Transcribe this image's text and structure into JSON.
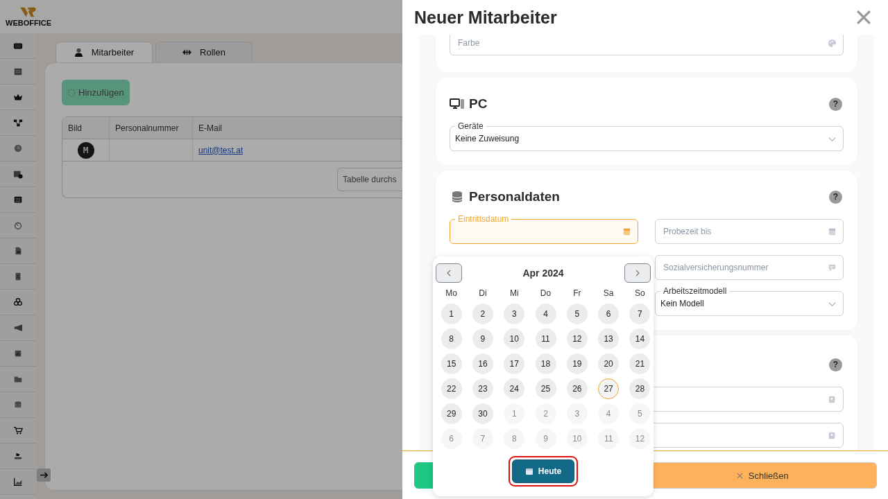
{
  "app": {
    "logo": "WEBOFFICE",
    "tabs": [
      {
        "label": "Mitarbeiter",
        "selected": true
      },
      {
        "label": "Rollen",
        "selected": false
      }
    ],
    "add_button": {
      "label": "Hinzufügen",
      "disabled": true
    },
    "table": {
      "columns": [
        "Bild",
        "Personalnummer",
        "E-Mail"
      ],
      "rows": [
        {
          "avatar": "M",
          "email": "unit@test.at"
        }
      ]
    },
    "search": {
      "placeholder": "Tabelle durchs"
    }
  },
  "modal": {
    "title": "Neuer Mitarbeiter",
    "sections": [
      {
        "kind": "plain",
        "columns": [
          [
            {
              "kind": "color",
              "placeholder": "Farbe"
            }
          ]
        ]
      },
      {
        "kind": "pc",
        "title": "PC",
        "help": "?",
        "columns": [
          [
            {
              "kind": "select",
              "label": "Geräte",
              "value": "Keine Zuweisung"
            }
          ]
        ]
      },
      {
        "kind": "data",
        "title": "Personaldaten",
        "help": "?",
        "columns": [
          [
            {
              "kind": "date",
              "label": "Eintrittsdatum",
              "focused": true
            }
          ],
          [
            {
              "kind": "date",
              "placeholder": "Probezeit bis"
            },
            {
              "kind": "note",
              "placeholder": "Sozialversicherungsnummer"
            },
            {
              "kind": "select",
              "label": "Arbeitszeitmodell",
              "value": "Kein Modell"
            }
          ]
        ]
      },
      {
        "kind": "contact",
        "help": "?",
        "columns": [
          [
            {
              "kind": "contact"
            },
            {
              "kind": "contact"
            }
          ]
        ]
      }
    ],
    "footer": [
      {
        "kind": "save"
      },
      {
        "kind": "close",
        "label": "Schließen"
      }
    ]
  },
  "datepicker": {
    "month": "Apr 2024",
    "weekdays": [
      "Mo",
      "Di",
      "Mi",
      "Do",
      "Fr",
      "Sa",
      "So"
    ],
    "days": [
      {
        "label": "1",
        "other_month": false,
        "today": false
      },
      {
        "label": "2",
        "other_month": false,
        "today": false
      },
      {
        "label": "3",
        "other_month": false,
        "today": false
      },
      {
        "label": "4",
        "other_month": false,
        "today": false
      },
      {
        "label": "5",
        "other_month": false,
        "today": false
      },
      {
        "label": "6",
        "other_month": false,
        "today": false
      },
      {
        "label": "7",
        "other_month": false,
        "today": false
      },
      {
        "label": "8",
        "other_month": false,
        "today": false
      },
      {
        "label": "9",
        "other_month": false,
        "today": false
      },
      {
        "label": "10",
        "other_month": false,
        "today": false
      },
      {
        "label": "11",
        "other_month": false,
        "today": false
      },
      {
        "label": "12",
        "other_month": false,
        "today": false
      },
      {
        "label": "13",
        "other_month": false,
        "today": false
      },
      {
        "label": "14",
        "other_month": false,
        "today": false
      },
      {
        "label": "15",
        "other_month": false,
        "today": false
      },
      {
        "label": "16",
        "other_month": false,
        "today": false
      },
      {
        "label": "17",
        "other_month": false,
        "today": false
      },
      {
        "label": "18",
        "other_month": false,
        "today": false
      },
      {
        "label": "19",
        "other_month": false,
        "today": false
      },
      {
        "label": "20",
        "other_month": false,
        "today": false
      },
      {
        "label": "21",
        "other_month": false,
        "today": false
      },
      {
        "label": "22",
        "other_month": false,
        "today": false
      },
      {
        "label": "23",
        "other_month": false,
        "today": false
      },
      {
        "label": "24",
        "other_month": false,
        "today": false
      },
      {
        "label": "25",
        "other_month": false,
        "today": false
      },
      {
        "label": "26",
        "other_month": false,
        "today": false
      },
      {
        "label": "27",
        "other_month": false,
        "today": true
      },
      {
        "label": "28",
        "other_month": false,
        "today": false
      },
      {
        "label": "29",
        "other_month": false,
        "today": false
      },
      {
        "label": "30",
        "other_month": false,
        "today": false
      },
      {
        "label": "1",
        "other_month": true,
        "today": false
      },
      {
        "label": "2",
        "other_month": true,
        "today": false
      },
      {
        "label": "3",
        "other_month": true,
        "today": false
      },
      {
        "label": "4",
        "other_month": true,
        "today": false
      },
      {
        "label": "5",
        "other_month": true,
        "today": false
      },
      {
        "label": "6",
        "other_month": true,
        "today": false
      },
      {
        "label": "7",
        "other_month": true,
        "today": false
      },
      {
        "label": "8",
        "other_month": true,
        "today": false
      },
      {
        "label": "9",
        "other_month": true,
        "today": false
      },
      {
        "label": "10",
        "other_month": true,
        "today": false
      },
      {
        "label": "11",
        "other_month": true,
        "today": false
      },
      {
        "label": "12",
        "other_month": true,
        "today": false
      }
    ],
    "today_button": {
      "label": "Heute",
      "highlighted": true
    }
  }
}
